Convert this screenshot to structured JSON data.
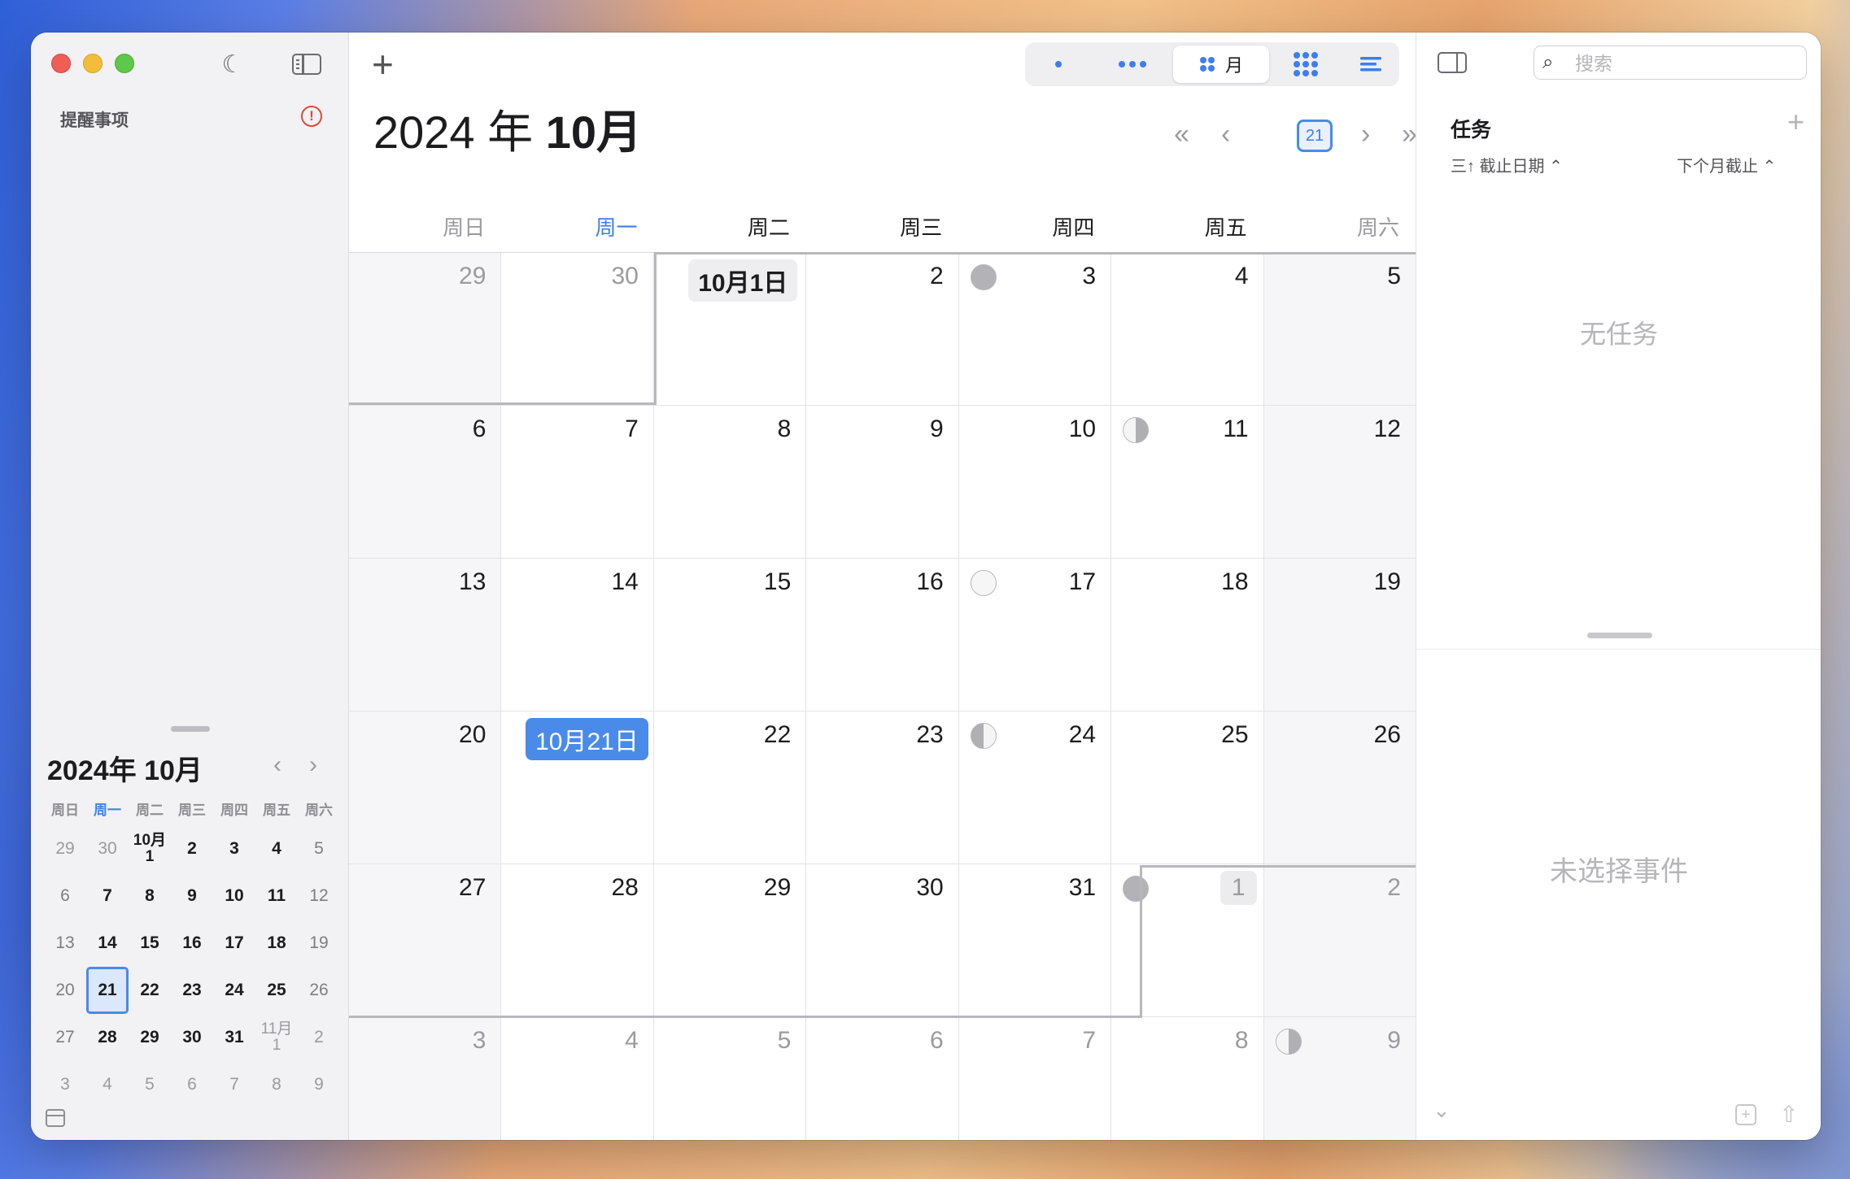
{
  "sidebar": {
    "reminders_label": "提醒事项",
    "alert_glyph": "!",
    "mini_calendar": {
      "title": "2024年 10月",
      "weekdays": [
        "周日",
        "周一",
        "周二",
        "周三",
        "周四",
        "周五",
        "周六"
      ],
      "today_weekday_index": 1,
      "weeks": [
        [
          {
            "t": "29",
            "s": "dim"
          },
          {
            "t": "30",
            "s": "dim"
          },
          {
            "t": "10月\n1",
            "s": "small"
          },
          {
            "t": "2"
          },
          {
            "t": "3"
          },
          {
            "t": "4"
          },
          {
            "t": "5",
            "s": "wk"
          }
        ],
        [
          {
            "t": "6",
            "s": "wk"
          },
          {
            "t": "7"
          },
          {
            "t": "8"
          },
          {
            "t": "9"
          },
          {
            "t": "10"
          },
          {
            "t": "11"
          },
          {
            "t": "12",
            "s": "wk"
          }
        ],
        [
          {
            "t": "13",
            "s": "wk"
          },
          {
            "t": "14"
          },
          {
            "t": "15"
          },
          {
            "t": "16"
          },
          {
            "t": "17"
          },
          {
            "t": "18"
          },
          {
            "t": "19",
            "s": "wk"
          }
        ],
        [
          {
            "t": "20",
            "s": "wk"
          },
          {
            "t": "21",
            "s": "sel"
          },
          {
            "t": "22"
          },
          {
            "t": "23"
          },
          {
            "t": "24"
          },
          {
            "t": "25"
          },
          {
            "t": "26",
            "s": "wk"
          }
        ],
        [
          {
            "t": "27",
            "s": "wk"
          },
          {
            "t": "28"
          },
          {
            "t": "29"
          },
          {
            "t": "30"
          },
          {
            "t": "31"
          },
          {
            "t": "11月\n1",
            "s": "dim small"
          },
          {
            "t": "2",
            "s": "dim"
          }
        ],
        [
          {
            "t": "3",
            "s": "dim"
          },
          {
            "t": "4",
            "s": "dim"
          },
          {
            "t": "5",
            "s": "dim"
          },
          {
            "t": "6",
            "s": "dim"
          },
          {
            "t": "7",
            "s": "dim"
          },
          {
            "t": "8",
            "s": "dim"
          },
          {
            "t": "9",
            "s": "dim"
          }
        ]
      ]
    }
  },
  "toolbar": {
    "add_glyph": "+",
    "month_view_label": "月",
    "today_number": "21"
  },
  "header": {
    "year": "2024 年 ",
    "month": "10月"
  },
  "weekdays": [
    "周日",
    "周一",
    "周二",
    "周三",
    "周四",
    "周五",
    "周六"
  ],
  "today_weekday_index": 1,
  "weeks": [
    [
      {
        "d": "29",
        "out": true
      },
      {
        "d": "30",
        "out": true
      },
      {
        "d": "10月1日",
        "style": "pill"
      },
      {
        "d": "2"
      },
      {
        "d": "3",
        "moon": "new"
      },
      {
        "d": "4"
      },
      {
        "d": "5"
      }
    ],
    [
      {
        "d": "6"
      },
      {
        "d": "7"
      },
      {
        "d": "8"
      },
      {
        "d": "9"
      },
      {
        "d": "10"
      },
      {
        "d": "11",
        "moon": "half-l"
      },
      {
        "d": "12"
      }
    ],
    [
      {
        "d": "13"
      },
      {
        "d": "14"
      },
      {
        "d": "15"
      },
      {
        "d": "16"
      },
      {
        "d": "17",
        "moon": "full"
      },
      {
        "d": "18"
      },
      {
        "d": "19"
      }
    ],
    [
      {
        "d": "20"
      },
      {
        "d": "10月21日",
        "style": "today-pill"
      },
      {
        "d": "22"
      },
      {
        "d": "23"
      },
      {
        "d": "24",
        "moon": "half-r"
      },
      {
        "d": "25"
      },
      {
        "d": "26"
      }
    ],
    [
      {
        "d": "27"
      },
      {
        "d": "28"
      },
      {
        "d": "29"
      },
      {
        "d": "30"
      },
      {
        "d": "31"
      },
      {
        "d": "1",
        "out": true,
        "style": "next-pill",
        "moon": "new"
      },
      {
        "d": "2",
        "out": true
      }
    ],
    [
      {
        "d": "3",
        "out": true
      },
      {
        "d": "4",
        "out": true
      },
      {
        "d": "5",
        "out": true
      },
      {
        "d": "6",
        "out": true
      },
      {
        "d": "7",
        "out": true
      },
      {
        "d": "8",
        "out": true
      },
      {
        "d": "9",
        "out": true,
        "moon": "half-l"
      }
    ]
  ],
  "right_panel": {
    "search_placeholder": "搜索",
    "tasks_title": "任务",
    "add_glyph": "+",
    "sort_label": "三↑ 截止日期 ⌃",
    "range_label": "下个月截止 ⌃",
    "empty_tasks": "无任务",
    "no_event": "未选择事件"
  }
}
